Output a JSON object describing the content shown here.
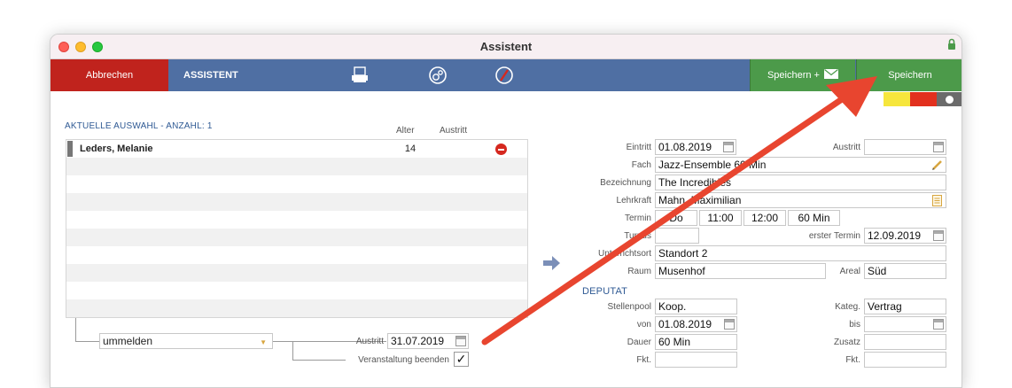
{
  "window": {
    "title": "Assistent"
  },
  "toolbar": {
    "cancel_label": "Abbrechen",
    "title": "ASSISTENT",
    "icons": [
      "printer-icon",
      "settings-icon",
      "no-entry-icon"
    ],
    "save_mail_label": "Speichern +",
    "save_label": "Speichern"
  },
  "status_colors": [
    "#f6e63c",
    "#e2301e",
    "#6b6b6b"
  ],
  "left": {
    "section_title": "AKTUELLE AUSWAHL - ANZAHL: 1",
    "col_alter": "Alter",
    "col_austritt": "Austritt",
    "rows": [
      {
        "name": "Leders, Melanie",
        "age": "14"
      }
    ],
    "action": "ummelden",
    "austritt_label": "Austritt",
    "austritt_value": "31.07.2019",
    "end_label": "Veranstaltung beenden",
    "end_checked": "✓"
  },
  "form": {
    "eintritt_label": "Eintritt",
    "eintritt_value": "01.08.2019",
    "austritt_label": "Austritt",
    "austritt_value": "",
    "fach_label": "Fach",
    "fach_value": "Jazz-Ensemble 60 Min",
    "bezeichnung_label": "Bezeichnung",
    "bezeichnung_value": "The Incredibles",
    "lehrkraft_label": "Lehrkraft",
    "lehrkraft_value": "Mahn, Maximilian",
    "termin_label": "Termin",
    "termin_day": "Do",
    "termin_from": "11:00",
    "termin_to": "12:00",
    "termin_duration": "60 Min",
    "turnus_label": "Turnus",
    "turnus_value": "",
    "erster_termin_label": "erster Termin",
    "erster_termin_value": "12.09.2019",
    "ort_label": "Unterrichtsort",
    "ort_value": "Standort 2",
    "raum_label": "Raum",
    "raum_value": "Musenhof",
    "areal_label": "Areal",
    "areal_value": "Süd",
    "deputat_title": "DEPUTAT",
    "stellenpool_label": "Stellenpool",
    "stellenpool_value": "Koop.",
    "kateg_label": "Kateg.",
    "kateg_value": "Vertrag",
    "von_label": "von",
    "von_value": "01.08.2019",
    "bis_label": "bis",
    "bis_value": "",
    "dauer_label": "Dauer",
    "dauer_value": "60 Min",
    "zusatz_label": "Zusatz",
    "zusatz_value": "",
    "fkt1_label": "Fkt.",
    "fkt2_label": "Fkt."
  },
  "annotation": {
    "color": "#e8452f"
  }
}
